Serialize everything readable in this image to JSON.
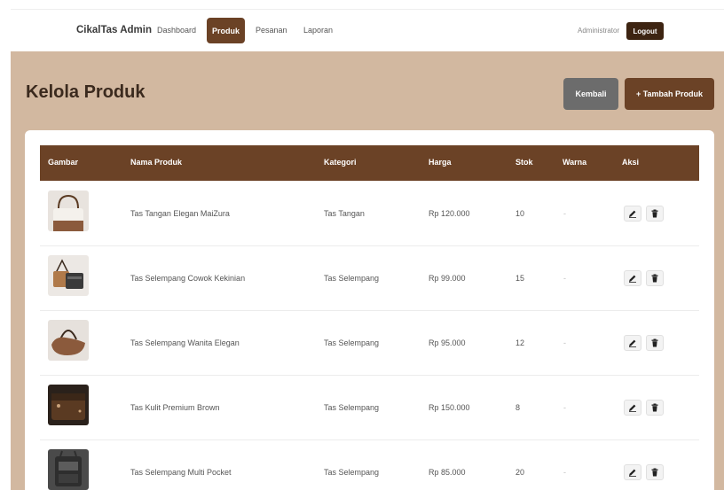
{
  "nav": {
    "brand": "CikalTas Admin",
    "links": [
      "Dashboard",
      "Produk",
      "Pesanan",
      "Laporan"
    ],
    "user": "Administrator",
    "logout": "Logout"
  },
  "page": {
    "title": "Kelola Produk",
    "back_label": "Kembali",
    "add_label": "+ Tambah Produk"
  },
  "table": {
    "headers": [
      "Gambar",
      "Nama Produk",
      "Kategori",
      "Harga",
      "Stok",
      "Warna",
      "Aksi"
    ],
    "rows": [
      {
        "name": "Tas Tangan Elegan MaiZura",
        "category": "Tas Tangan",
        "price": "Rp 120.000",
        "stock": "10",
        "color": "-"
      },
      {
        "name": "Tas Selempang Cowok Kekinian",
        "category": "Tas Selempang",
        "price": "Rp 99.000",
        "stock": "15",
        "color": "-"
      },
      {
        "name": "Tas Selempang Wanita Elegan",
        "category": "Tas Selempang",
        "price": "Rp 95.000",
        "stock": "12",
        "color": "-"
      },
      {
        "name": "Tas Kulit Premium Brown",
        "category": "Tas Selempang",
        "price": "Rp 150.000",
        "stock": "8",
        "color": "-"
      },
      {
        "name": "Tas Selempang Multi Pocket",
        "category": "Tas Selempang",
        "price": "Rp 85.000",
        "stock": "20",
        "color": "-"
      }
    ]
  },
  "icons": {
    "edit": "pencil-icon",
    "delete": "trash-icon"
  },
  "colors": {
    "primary": "#6b4226",
    "background": "#d2b8a0",
    "logout": "#3d2412",
    "back": "#6c6c6c"
  }
}
